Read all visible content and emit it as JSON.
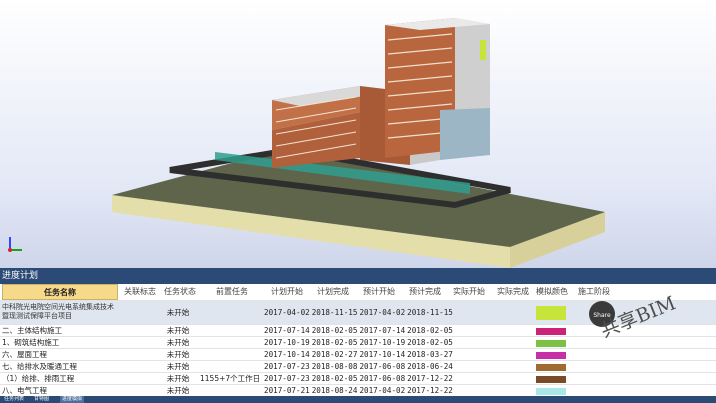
{
  "panel": {
    "title": "进度计划"
  },
  "columns": [
    "任务名称",
    "关联标志",
    "任务状态",
    "前置任务",
    "计划开始",
    "计划完成",
    "预计开始",
    "预计完成",
    "实际开始",
    "实际完成",
    "模拟颜色",
    "施工阶段"
  ],
  "rows": [
    {
      "name": "中科院光电院空间光电系统集成技术暨现测试保障平台项目",
      "status": "未开始",
      "pre": "",
      "plan_start": "2017-04-02",
      "plan_end": "2018-11-15",
      "exp_start": "2017-04-02",
      "exp_end": "2018-11-15",
      "color": "#c6e43a",
      "selected": true
    },
    {
      "name": "二、主体结构施工",
      "status": "未开始",
      "pre": "",
      "plan_start": "2017-07-14",
      "plan_end": "2018-02-05",
      "exp_start": "2017-07-14",
      "exp_end": "2018-02-05",
      "color": "#cc2277",
      "selected": false
    },
    {
      "name": "1、砌筑结构施工",
      "status": "未开始",
      "pre": "",
      "plan_start": "2017-10-19",
      "plan_end": "2018-02-05",
      "exp_start": "2017-10-19",
      "exp_end": "2018-02-05",
      "color": "#7cc046",
      "selected": false
    },
    {
      "name": "六、屋面工程",
      "status": "未开始",
      "pre": "",
      "plan_start": "2017-10-14",
      "plan_end": "2018-02-27",
      "exp_start": "2017-10-14",
      "exp_end": "2018-03-27",
      "color": "#c62fa6",
      "selected": false
    },
    {
      "name": "七、给排水及暖通工程",
      "status": "未开始",
      "pre": "",
      "plan_start": "2017-07-23",
      "plan_end": "2018-08-08",
      "exp_start": "2017-06-08",
      "exp_end": "2018-06-24",
      "color": "#a06a30",
      "selected": false
    },
    {
      "name": "（1）给排、排雨工程",
      "status": "未开始",
      "pre": "1155+7个工作日",
      "plan_start": "2017-07-23",
      "plan_end": "2018-02-05",
      "exp_start": "2017-06-08",
      "exp_end": "2017-12-22",
      "color": "#7a4a26",
      "selected": false
    },
    {
      "name": "八、电气工程",
      "status": "未开始",
      "pre": "",
      "plan_start": "2017-07-21",
      "plan_end": "2018-08-24",
      "exp_start": "2017-04-02",
      "exp_end": "2017-12-22",
      "color": "#a9e8e8",
      "selected": false
    }
  ],
  "bottom_tabs": [
    "任务列表",
    "甘特图",
    "进度模拟"
  ],
  "watermark": {
    "text": "共享BIM",
    "badge": "Share"
  }
}
